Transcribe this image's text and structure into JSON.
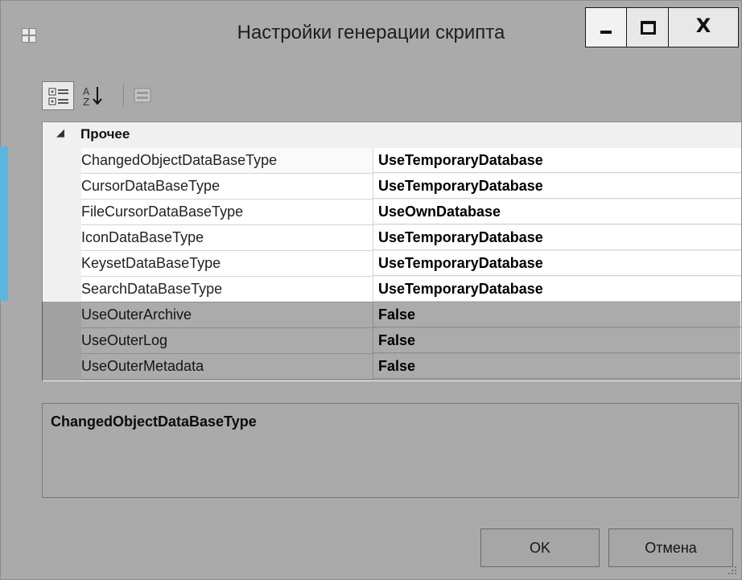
{
  "window": {
    "title": "Настройки генерации скрипта",
    "controls": {
      "minimize": "minimize",
      "maximize": "maximize",
      "close": "X"
    }
  },
  "toolbar": {
    "categorized": "categorized-icon",
    "alphabetical": "sort-az-icon",
    "property_pages": "property-pages-icon"
  },
  "grid": {
    "category": "Прочее",
    "category_toggle": "◢",
    "rows": [
      {
        "name": "ChangedObjectDataBaseType",
        "value": "UseTemporaryDatabase"
      },
      {
        "name": "CursorDataBaseType",
        "value": "UseTemporaryDatabase"
      },
      {
        "name": "FileCursorDataBaseType",
        "value": "UseOwnDatabase"
      },
      {
        "name": "IconDataBaseType",
        "value": "UseTemporaryDatabase"
      },
      {
        "name": "KeysetDataBaseType",
        "value": "UseTemporaryDatabase"
      },
      {
        "name": "SearchDataBaseType",
        "value": "UseTemporaryDatabase"
      },
      {
        "name": "UseOuterArchive",
        "value": "False"
      },
      {
        "name": "UseOuterLog",
        "value": "False"
      },
      {
        "name": "UseOuterMetadata",
        "value": "False"
      }
    ]
  },
  "description": {
    "title": "ChangedObjectDataBaseType"
  },
  "buttons": {
    "ok": "OK",
    "cancel": "Отмена"
  },
  "colors": {
    "accent": "#5cb5de",
    "chrome": "#aaaaaa"
  }
}
